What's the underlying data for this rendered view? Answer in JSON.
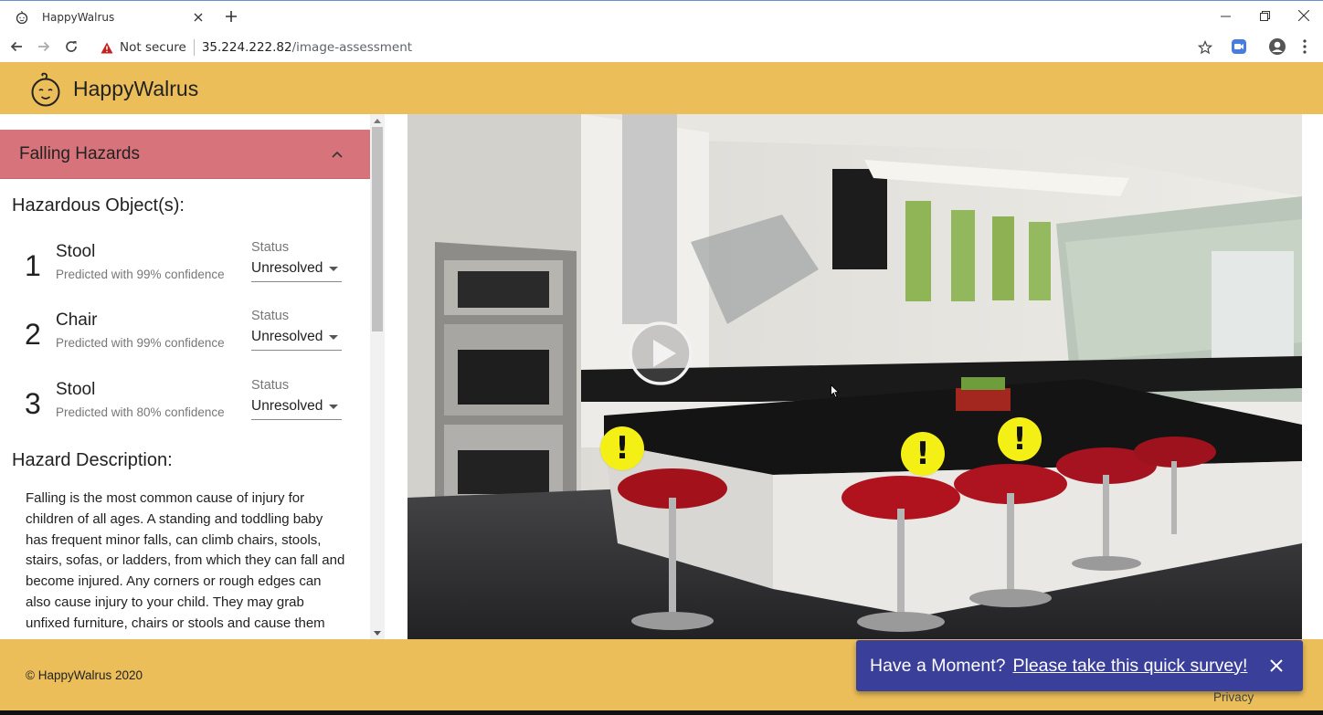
{
  "browser": {
    "tab_title": "HappyWalrus",
    "security_label": "Not secure",
    "url_host": "35.224.222.82",
    "url_path": "/image-assessment"
  },
  "app": {
    "brand": "HappyWalrus"
  },
  "panel": {
    "category": "Falling Hazards",
    "objects_title": "Hazardous Object(s):",
    "status_label": "Status",
    "objects": [
      {
        "num": "1",
        "name": "Stool",
        "confidence": "Predicted with 99% confidence",
        "status": "Unresolved"
      },
      {
        "num": "2",
        "name": "Chair",
        "confidence": "Predicted with 99% confidence",
        "status": "Unresolved"
      },
      {
        "num": "3",
        "name": "Stool",
        "confidence": "Predicted with 80% confidence",
        "status": "Unresolved"
      }
    ],
    "description_title": "Hazard Description:",
    "description": "Falling is the most common cause of injury for children of all ages. A standing and toddling baby has frequent minor falls, can climb chairs, stools, stairs, sofas, or ladders, from which they can fall and become injured. Any corners or rough edges can also cause injury to your child. They may grab unfixed furniture, chairs or stools and cause them"
  },
  "image": {
    "marker_symbol": "!"
  },
  "footer": {
    "copyright": "© HappyWalrus 2020",
    "privacy": "Privacy"
  },
  "survey": {
    "question": "Have a Moment?",
    "link": "Please take this quick survey!"
  },
  "colors": {
    "header": "#ebbe5a",
    "accordion": "#d7737a",
    "marker": "#f4ef14",
    "survey": "#3a3f9a"
  }
}
